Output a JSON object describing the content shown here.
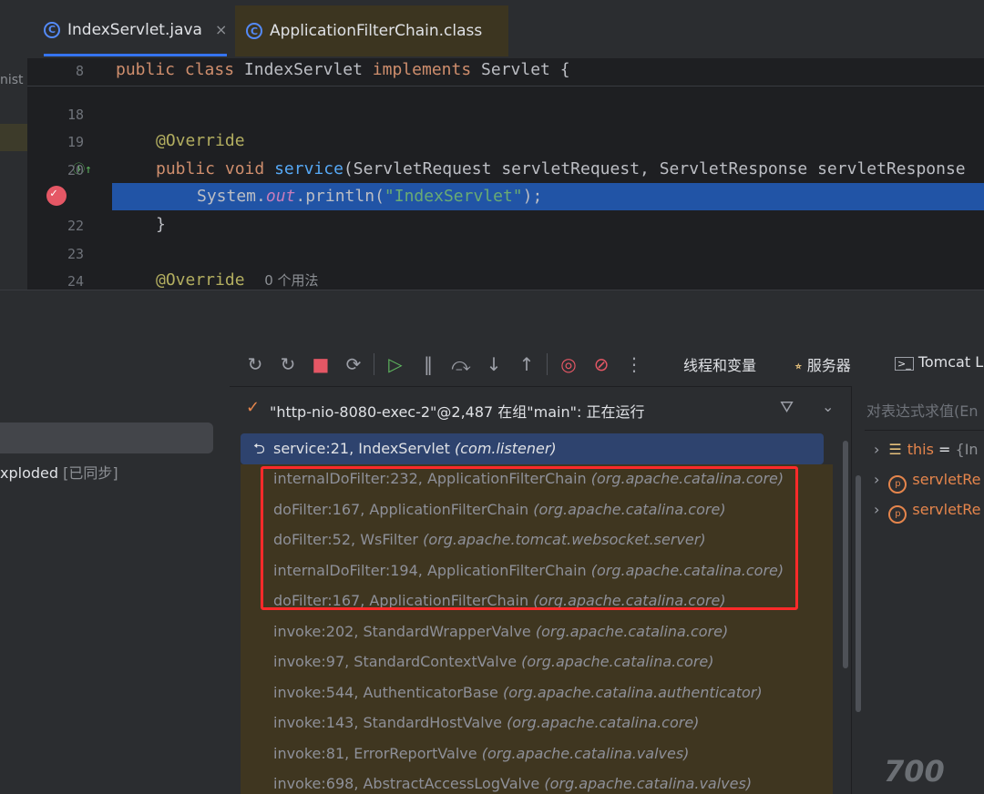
{
  "tabs": [
    {
      "label": "IndexServlet.java",
      "icon": "class-icon",
      "active": true,
      "closable": true
    },
    {
      "label": "ApplicationFilterChain.class",
      "icon": "class-file-icon",
      "active": false
    }
  ],
  "left_stub": {
    "text": "nist"
  },
  "editor": {
    "sticky": {
      "line": "8",
      "code": "public class IndexServlet implements Servlet {"
    },
    "lines": [
      {
        "num": "18",
        "code": ""
      },
      {
        "num": "19",
        "code": "@Override"
      },
      {
        "num": "20",
        "code": "public void service(ServletRequest servletRequest, ServletResponse servletResponse"
      },
      {
        "num": "21",
        "code": "System.out.println(\"IndexServlet\");"
      },
      {
        "num": "22",
        "code": "}"
      },
      {
        "num": "23",
        "code": ""
      },
      {
        "num": "24",
        "code": "@Override"
      }
    ],
    "usage_hint": "0 个用法"
  },
  "project": {
    "item_label": "xploded",
    "item_tag": "[已同步]"
  },
  "debug_tabs": [
    {
      "label": "线程和变量",
      "icon": "",
      "active": true
    },
    {
      "label": "服务器",
      "icon": "server-icon",
      "active": false
    },
    {
      "label": "Tomcat L",
      "icon": "console-icon",
      "active": false
    }
  ],
  "thread": {
    "text": "\"http-nio-8080-exec-2\"@2,487 在组\"main\": 正在运行"
  },
  "current_frame": {
    "method": "service:21, IndexServlet",
    "pkg": "(com.listener)"
  },
  "frames": [
    {
      "method": "internalDoFilter:232, ApplicationFilterChain",
      "pkg": "(org.apache.catalina.core)"
    },
    {
      "method": "doFilter:167, ApplicationFilterChain",
      "pkg": "(org.apache.catalina.core)"
    },
    {
      "method": "doFilter:52, WsFilter",
      "pkg": "(org.apache.tomcat.websocket.server)"
    },
    {
      "method": "internalDoFilter:194, ApplicationFilterChain",
      "pkg": "(org.apache.catalina.core)"
    },
    {
      "method": "doFilter:167, ApplicationFilterChain",
      "pkg": "(org.apache.catalina.core)"
    },
    {
      "method": "invoke:202, StandardWrapperValve",
      "pkg": "(org.apache.catalina.core)"
    },
    {
      "method": "invoke:97, StandardContextValve",
      "pkg": "(org.apache.catalina.core)"
    },
    {
      "method": "invoke:544, AuthenticatorBase",
      "pkg": "(org.apache.catalina.authenticator)"
    },
    {
      "method": "invoke:143, StandardHostValve",
      "pkg": "(org.apache.catalina.core)"
    },
    {
      "method": "invoke:81, ErrorReportValve",
      "pkg": "(org.apache.catalina.valves)"
    },
    {
      "method": "invoke:698, AbstractAccessLogValve",
      "pkg": "(org.apache.catalina.valves)"
    }
  ],
  "variables": {
    "eval_placeholder": "对表达式求值(En",
    "items": [
      {
        "name": "this",
        "eq": " = ",
        "value": "{In",
        "icon": "field-lines-icon"
      },
      {
        "name": "servletRe",
        "eq": "",
        "value": "",
        "icon": "param-icon"
      },
      {
        "name": "servletRe",
        "eq": "",
        "value": "",
        "icon": "param-icon"
      }
    ]
  },
  "watermark": {
    "text": "700"
  },
  "colors": {
    "accent": "#3574f0",
    "highlight_line": "#2154a6",
    "breakpoint": "#e55765",
    "annotation_box": "#ff2a2a"
  }
}
